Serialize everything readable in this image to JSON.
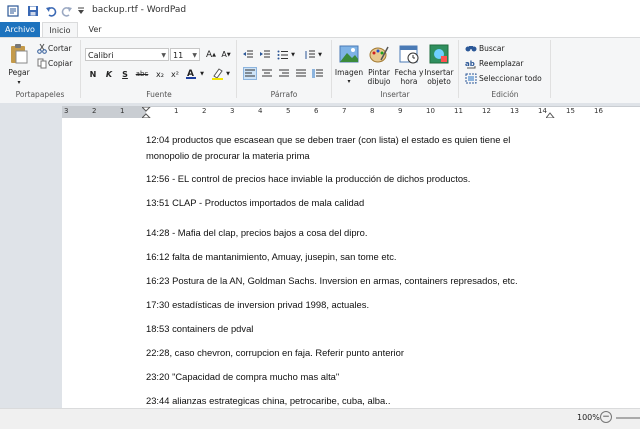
{
  "window": {
    "title": "backup.rtf - WordPad"
  },
  "tabs": {
    "file": "Archivo",
    "home": "Inicio",
    "view": "Ver"
  },
  "clipboard": {
    "paste": "Pegar",
    "cut": "Cortar",
    "copy": "Copiar",
    "group": "Portapapeles"
  },
  "font": {
    "name": "Calibri",
    "size": "11",
    "group": "Fuente",
    "bold": "N",
    "italic": "K",
    "underline": "S",
    "strike": "abc",
    "subscript": "x₂",
    "superscript": "x²"
  },
  "paragraph": {
    "group": "Párrafo"
  },
  "insert": {
    "image": "Imagen",
    "paint": "Pintar dibujo",
    "datetime": "Fecha y hora",
    "object": "Insertar objeto",
    "group": "Insertar"
  },
  "edit": {
    "find": "Buscar",
    "replace": "Reemplazar",
    "selectall": "Seleccionar todo",
    "group": "Edición"
  },
  "ruler": {
    "numbers": [
      "3",
      "2",
      "1",
      "1",
      "2",
      "3",
      "4",
      "5",
      "6",
      "7",
      "8",
      "9",
      "10",
      "11",
      "12",
      "13",
      "14",
      "15",
      "16"
    ]
  },
  "document": {
    "lines": [
      "12:04 productos que escasean que se deben traer (con lista) el estado es quien tiene el",
      "monopolio de procurar la materia prima",
      "12:56 - EL control de precios hace inviable la producción de dichos productos.",
      "13:51 CLAP - Productos importados de mala calidad",
      "14:28 -  Mafia del clap, precios bajos a cosa del dipro.",
      "16:12 falta de mantanimiento, Amuay, jusepin, san tome etc.",
      "16:23 Postura de la AN, Goldman Sachs. Inversion en armas, containers represados, etc.",
      "17:30 estadísticas de inversion privad 1998, actuales.",
      "18:53 containers de pdval",
      "22:28, caso chevron, corrupcion en faja. Referir punto anterior",
      "23:20 \"Capacidad de compra mucho mas alta\"",
      "23:44 alianzas estrategicas china, petrocaribe, cuba, alba.."
    ]
  },
  "status": {
    "zoom": "100%"
  }
}
